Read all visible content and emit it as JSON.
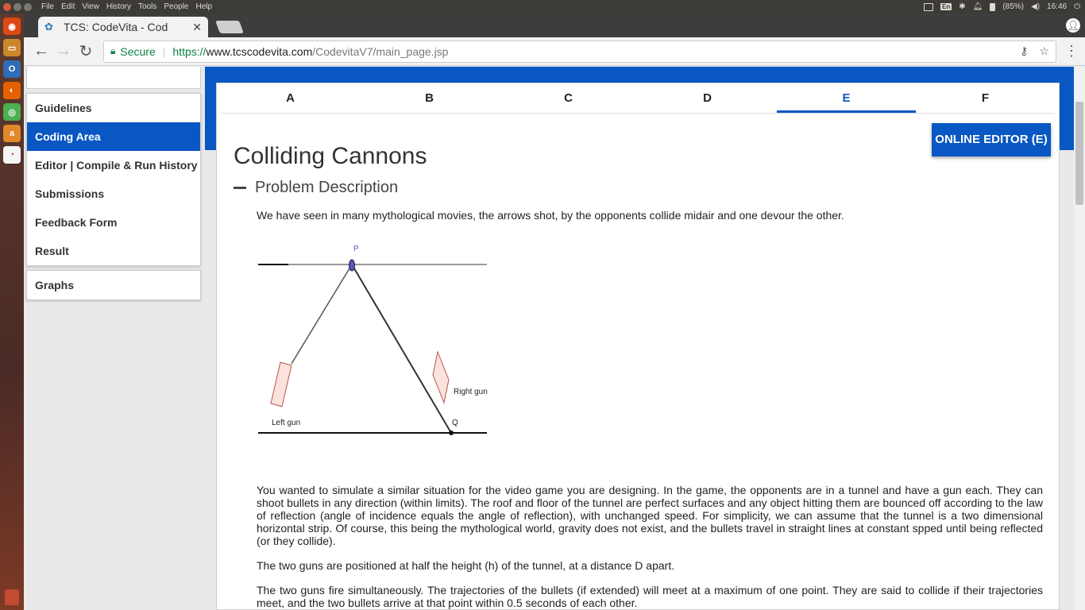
{
  "system_bar": {
    "menu": [
      "File",
      "Edit",
      "View",
      "History",
      "Tools",
      "People",
      "Help"
    ],
    "language": "En",
    "battery": "(85%)",
    "time": "16:46"
  },
  "browser": {
    "tab_title": "TCS: CodeVita - Cod",
    "secure_label": "Secure",
    "url_scheme": "https://",
    "url_host": "www.tcscodevita.com",
    "url_path": "/CodevitaV7/main_page.jsp"
  },
  "sidebar": {
    "items": [
      "Guidelines",
      "Coding Area",
      "Editor | Compile & Run History",
      "Submissions",
      "Feedback Form",
      "Result"
    ],
    "active": "Coding Area",
    "graphs": "Graphs"
  },
  "problem_tabs": [
    "A",
    "B",
    "C",
    "D",
    "E",
    "F"
  ],
  "active_tab": "E",
  "editor_button": "ONLINE EDITOR (E)",
  "problem": {
    "title": "Colliding Cannons",
    "section": "Problem Description",
    "intro": "We have seen in many mythological movies, the arrows shot, by the opponents collide midair and one devour the other.",
    "figure_labels": {
      "p": "P",
      "q": "Q",
      "left_gun": "Left gun",
      "right_gun": "Right gun"
    },
    "para1": "You wanted to simulate a similar situation for the video game you are designing. In the game, the opponents are in a tunnel and have a gun each. They can shoot bullets in any direction (within limits). The roof and floor of the tunnel are perfect surfaces and any object hitting them are bounced off according to the law of reflection (angle of incidence equals the angle of reflection), with unchanged speed. For simplicity, we can assume that the tunnel is a two dimensional horizontal strip. Of course, this being the mythological world, gravity does not exist, and the bullets travel in straight lines at constant spped until being reflected (or they collide).",
    "para2": "The two guns are positioned at half the height (h) of the tunnel, at a distance D apart.",
    "para3": "The two guns fire simultaneously. The trajectories of the bullets (if extended) will meet at a maximum of one point. They are said to collide if their trajectories meet, and the two bullets arrive at that point within 0.5 seconds of each other."
  }
}
